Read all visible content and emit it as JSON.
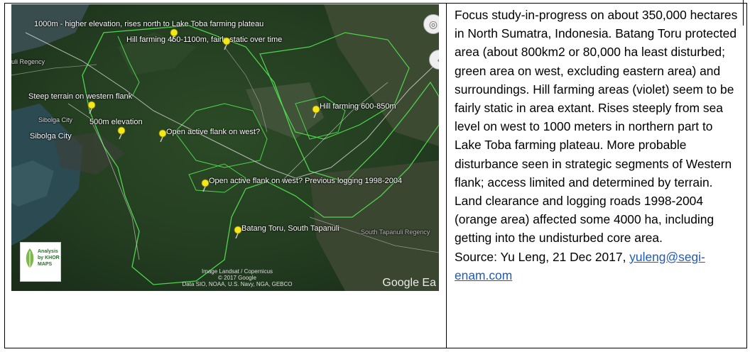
{
  "map": {
    "labels": {
      "top": "1000m - higher elevation, rises north to Lake Toba farming plateau",
      "hill_top": "Hill farming 450-1100m, fairly static over time",
      "regency_left": "uli Regency",
      "steep": "Steep terrain on western flank",
      "hill_right": "Hill farming 600-850m",
      "sibolga_small": "Sibolga City",
      "sibolga": "Sibolga City",
      "elev500": "500m elevation",
      "open_west": "Open active flank on west?",
      "open_logging": "Open active flank on west? Previous logging 1998-2004",
      "batang": "Batang Toru, South Tapanuli",
      "regency_right": "South Tapanuli Regency"
    },
    "credits": {
      "line1": "Image Landsat / Copernicus",
      "line2": "© 2017 Google",
      "line3": "Data SIO, NOAA, U.S. Navy, NGA, GEBCO"
    },
    "google": "Google Ea",
    "logo": {
      "line1": "Analysis",
      "line2": "by KHOR",
      "line3": "MAPS"
    },
    "colors": {
      "boundary": "#4fd44f",
      "road": "#d8d8d8",
      "pin": "#f2e81a"
    }
  },
  "text": {
    "body": "Focus study-in-progress on about 350,000 hectares in North Sumatra, Indonesia. Batang Toru protected area (about 800km2 or 80,000 ha least disturbed; green area on west, excluding eastern area) and surroundings. Hill farming areas (violet) seem to be fairly static in area extant. Rises steeply from sea level on west to 1000 meters in northern part to Lake Toba farming plateau. More probable disturbance seen in strategic segments of Western flank; access limited and determined by terrain. Land clearance and logging roads 1998-2004 (orange area) affected some 4000 ha, including getting into the undisturbed core area.",
    "source_prefix": "Source: Yu Leng, 21 Dec 2017, ",
    "email": "yuleng@segi-enam.com"
  }
}
